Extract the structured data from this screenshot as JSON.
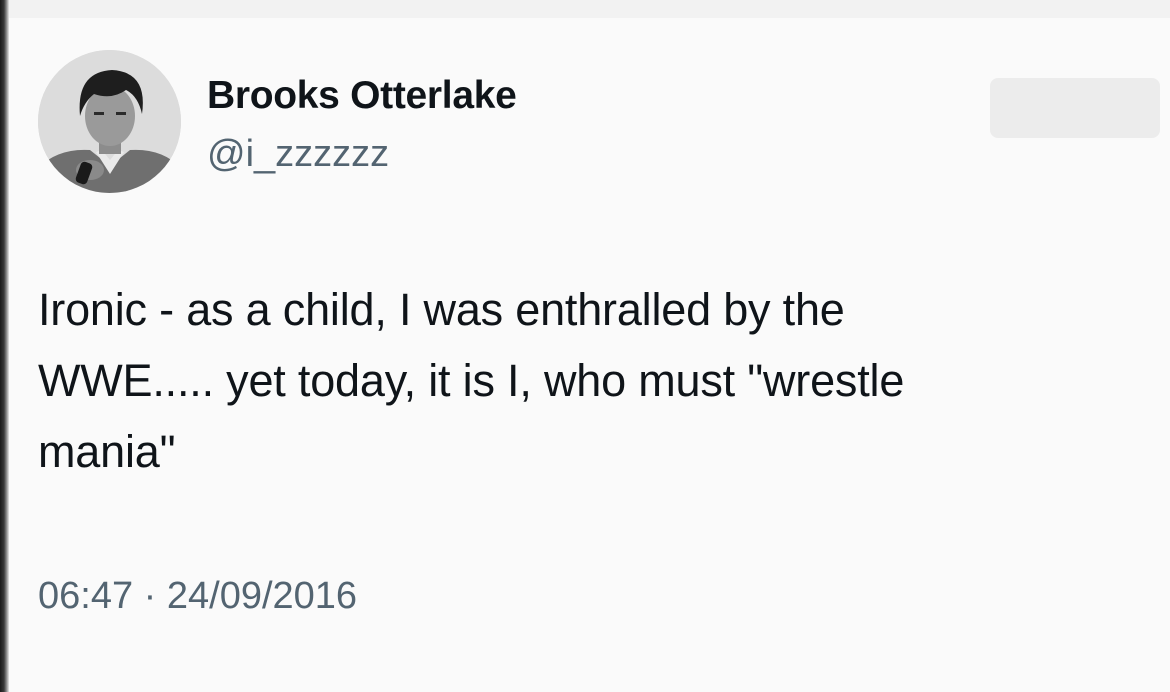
{
  "tweet": {
    "author": {
      "display_name": "Brooks Otterlake",
      "handle": "@i_zzzzzz",
      "avatar_icon": "avatar-photo"
    },
    "text": "Ironic - as a child, I was enthralled by the\nWWE..... yet today, it is I, who must \"wrestle\nmania\"",
    "time": "06:47",
    "separator": "·",
    "date": "24/09/2016"
  },
  "colors": {
    "background": "#fafafa",
    "text_primary": "#0f1419",
    "text_secondary": "#536471"
  }
}
